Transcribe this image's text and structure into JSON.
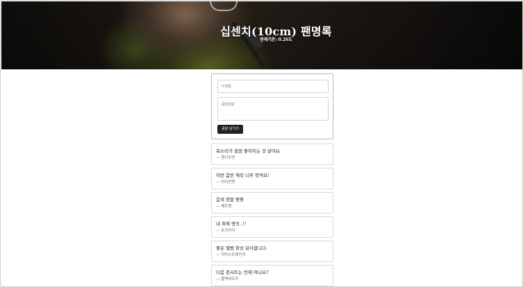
{
  "header": {
    "title": "십센치(10cm) 팬명록",
    "subtitle": "현재기온: 0.26도"
  },
  "form": {
    "name_placeholder": "닉네임",
    "comment_placeholder": "응원댓글",
    "submit_label": "응원 남기기"
  },
  "entries": [
    {
      "message": "목소리가 점점 좋아지는 것 같아요",
      "author": "— 젠더우먼"
    },
    {
      "message": "이번 음반 재킷 너무 멋져요!",
      "author": "— 아이언맨"
    },
    {
      "message": "음색 정말 짱짱",
      "author": "— 베트맨"
    },
    {
      "message": "내 최애 명곡..!!",
      "author": "— 호크아이"
    },
    {
      "message": "좋은 앨범 항상 감사합니다.",
      "author": "— 닥터스트레인지"
    },
    {
      "message": "다음 콘서트는 언제 여나요?",
      "author": "— 블랙위도우"
    }
  ]
}
